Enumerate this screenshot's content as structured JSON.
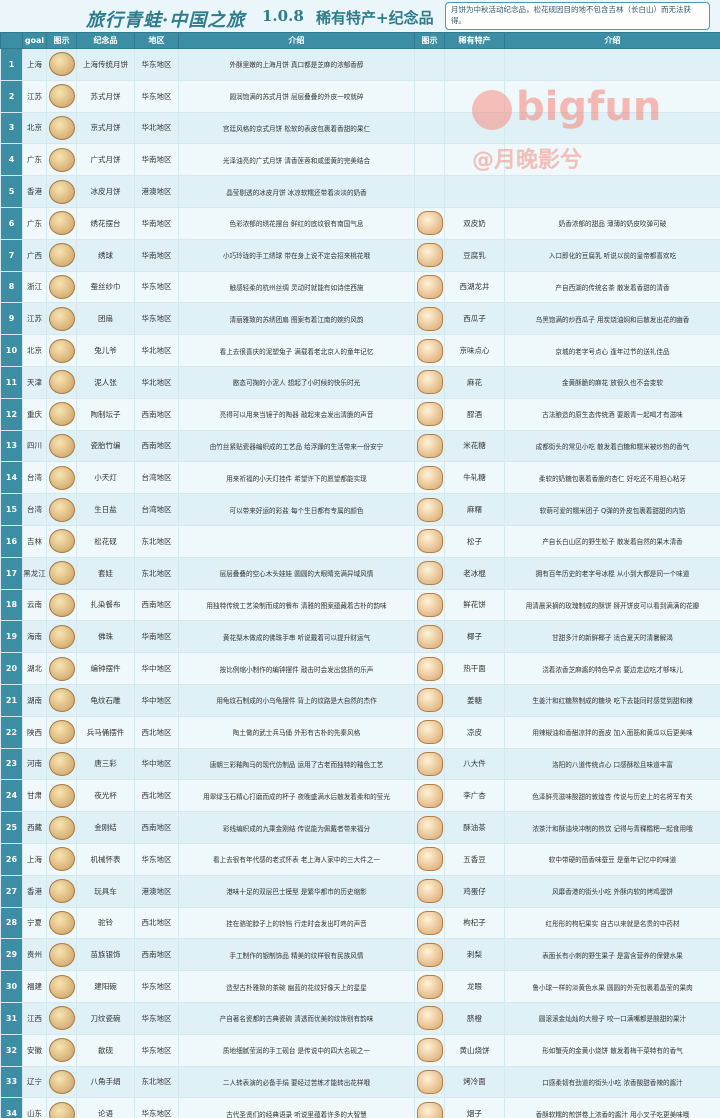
{
  "header": {
    "title": "旅行青蛙·中国之旅",
    "version": "1.0.8",
    "subtitle": "稀有特产+纪念品",
    "note": "月饼为中秋活动纪念品，松花砚因目的地不包含吉林（长白山）而无法获得。"
  },
  "watermark": {
    "brand": "bigfun",
    "author": "@月晚影兮"
  },
  "columns": [
    "goal",
    "图示",
    "纪念品",
    "地区",
    "介绍",
    "图示",
    "稀有特产",
    "介绍"
  ],
  "rows": [
    {
      "n": "1",
      "place": "上海",
      "item": "上海传统月饼",
      "region": "华东地区",
      "desc": "外酥里嫩的上海月饼 真口都是芝麻的浓郁香醇",
      "sp": "",
      "spdesc": ""
    },
    {
      "n": "2",
      "place": "江苏",
      "item": "苏式月饼",
      "region": "华东地区",
      "desc": "圆润饱满的苏式月饼 层层叠叠的外皮一咬就碎",
      "sp": "",
      "spdesc": ""
    },
    {
      "n": "3",
      "place": "北京",
      "item": "京式月饼",
      "region": "华北地区",
      "desc": "宫廷风格的京式月饼 松软的表皮包裹着香甜的果仁",
      "sp": "",
      "spdesc": ""
    },
    {
      "n": "4",
      "place": "广东",
      "item": "广式月饼",
      "region": "华南地区",
      "desc": "光泽油亮的广式月饼 清香莲蓉和咸蛋黄的完美结合",
      "sp": "",
      "spdesc": ""
    },
    {
      "n": "5",
      "place": "香港",
      "item": "冰皮月饼",
      "region": "港澳地区",
      "desc": "晶莹剔透的冰皮月饼 冰凉软糯还带着淡淡的奶香",
      "sp": "",
      "spdesc": ""
    },
    {
      "n": "6",
      "place": "广东",
      "item": "绣花摆台",
      "region": "华南地区",
      "desc": "色彩浓郁的绣花摆台 鲜红的底纹很有南国气息",
      "sp": "双皮奶",
      "spdesc": "奶香浓郁的甜品 薄薄的奶皮吹弹可破"
    },
    {
      "n": "7",
      "place": "广西",
      "item": "绣球",
      "region": "华南地区",
      "desc": "小巧玲珑的手工绣球 带在身上说不定会招来桃花哦",
      "sp": "豆腐乳",
      "spdesc": "入口即化的豆腐乳 听说以前的皇帝都喜欢吃"
    },
    {
      "n": "8",
      "place": "浙江",
      "item": "蚕丝纱巾",
      "region": "华东地区",
      "desc": "触感轻柔的杭州丝绸 灵动时就能有如诗佳西施",
      "sp": "西湖龙井",
      "spdesc": "产自西湖的传统名茶 散发着香甜的清香"
    },
    {
      "n": "9",
      "place": "江苏",
      "item": "团扇",
      "region": "华东地区",
      "desc": "清丽雅致的苏绣团扇 图案有着江南的婉约风韵",
      "sp": "西瓜子",
      "spdesc": "乌黑饱满的炒西瓜子 用炭烧油焖和后散发出花的幽香"
    },
    {
      "n": "10",
      "place": "北京",
      "item": "兔儿爷",
      "region": "华北地区",
      "desc": "看上去很喜庆的泥塑兔子 满载着老北京人的童年记忆",
      "sp": "京味点心",
      "spdesc": "京城的老字号点心 逢年过节的送礼佳品"
    },
    {
      "n": "11",
      "place": "天津",
      "item": "泥人张",
      "region": "华北地区",
      "desc": "憨态可掬的小泥人 想起了小时候的快乐时光",
      "sp": "麻花",
      "spdesc": "金黄酥脆的麻花 放很久也不会变软"
    },
    {
      "n": "12",
      "place": "重庆",
      "item": "陶制坛子",
      "region": "西南地区",
      "desc": "亮得可以用来当镜子的陶器 敲起来会发出清脆的声音",
      "sp": "醪酒",
      "spdesc": "古法酿造的原生态传统酒 要跟青一起喝才有滋味"
    },
    {
      "n": "13",
      "place": "四川",
      "item": "瓷胎竹编",
      "region": "西南地区",
      "desc": "由竹丝紧贴瓷器编织成的工艺品 给浮躁的生活带来一份安宁",
      "sp": "米花糖",
      "spdesc": "成都街头的常见小吃 散发着白糖和糯米被炒热的香气"
    },
    {
      "n": "14",
      "place": "台湾",
      "item": "小天灯",
      "region": "台湾地区",
      "desc": "用来祈福的小天灯挂件 希望许下的愿望都能实现",
      "sp": "牛轧糖",
      "spdesc": "柔软的奶糖包裹着香脆的杏仁 好吃还不用担心粘牙"
    },
    {
      "n": "15",
      "place": "台湾",
      "item": "生日盐",
      "region": "台湾地区",
      "desc": "可以带来好运的彩盐 每个生日都有专属的颜色",
      "sp": "麻糬",
      "spdesc": "软萌可爱的糯米团子 Q弹的外皮包裹着甜甜的内馅"
    },
    {
      "n": "16",
      "place": "吉林",
      "item": "松花砚",
      "region": "东北地区",
      "desc": "",
      "sp": "松子",
      "spdesc": "产自长白山区的野生松子 散发着自然的果木清香"
    },
    {
      "n": "17",
      "place": "黑龙江",
      "item": "套娃",
      "region": "东北地区",
      "desc": "层层叠叠的空心木头娃娃 圆圆的大眼睛充满异域风情",
      "sp": "老冰棍",
      "spdesc": "拥有百年历史的老字号冰棍 从小到大都是同一个味道"
    },
    {
      "n": "18",
      "place": "云南",
      "item": "扎染餐布",
      "region": "西南地区",
      "desc": "用独特传统工艺染制而成的餐布 清雅的图案蕴藏着古朴的韵味",
      "sp": "鲜花饼",
      "spdesc": "用清晨采摘的玫瑰制成的酥饼 掰开饼皮可以看到满满的花瓣"
    },
    {
      "n": "19",
      "place": "海南",
      "item": "佛珠",
      "region": "华南地区",
      "desc": "黄花梨木做成的佛珠手串 听说戴着可以提升财运气",
      "sp": "椰子",
      "spdesc": "甘甜多汁的新鲜椰子 适合夏天时清暑解渴"
    },
    {
      "n": "20",
      "place": "湖北",
      "item": "编钟摆件",
      "region": "华中地区",
      "desc": "按比例缩小制作的编钟摆件 敲击时会发出悠扬的乐声",
      "sp": "热干面",
      "spdesc": "浇着浓香芝麻酱的特色早点 要边走边吃才够味儿"
    },
    {
      "n": "21",
      "place": "湖南",
      "item": "龟纹石雕",
      "region": "华中地区",
      "desc": "用龟纹石制成的小乌龟摆件 背上的纹路是大自然的杰作",
      "sp": "姜糖",
      "spdesc": "生姜汁和红糖熬制成的糖块 吃下去能同时感觉到甜和辣"
    },
    {
      "n": "22",
      "place": "陕西",
      "item": "兵马俑摆件",
      "region": "西北地区",
      "desc": "陶土做的武士兵马俑 外形有古朴的先秦风格",
      "sp": "凉皮",
      "spdesc": "用辣椒油和香醋凉拌的面皮 加入面筋和黄瓜以后更美味"
    },
    {
      "n": "23",
      "place": "河南",
      "item": "唐三彩",
      "region": "华中地区",
      "desc": "唐朝三彩釉陶马的现代仿制品 运用了古老而独特的釉色工艺",
      "sp": "八大件",
      "spdesc": "洛阳的八道传统点心 口感酥松且味道丰富"
    },
    {
      "n": "24",
      "place": "甘肃",
      "item": "夜光杯",
      "region": "西北地区",
      "desc": "用翠绿玉石精心打磨而成的杯子 夜晚盛满水后散发着柔和的莹光",
      "sp": "李广杏",
      "spdesc": "色泽鲜亮滋味酸甜的敦煌杏 传说与历史上的名将军有关"
    },
    {
      "n": "25",
      "place": "西藏",
      "item": "金刚结",
      "region": "西南地区",
      "desc": "彩线编织成的九乘金刚结 传说能为佩戴者带来福分",
      "sp": "酥油茶",
      "spdesc": "浓茶汁和酥油块冲制的热饮 记得与青稞糌粑一起食用哦"
    },
    {
      "n": "26",
      "place": "上海",
      "item": "机械怀表",
      "region": "华东地区",
      "desc": "看上去很有年代感的老式怀表 老上海人家中的三大件之一",
      "sp": "五香豆",
      "spdesc": "软中带硬的茴香味蚕豆 是童年记忆中的味道"
    },
    {
      "n": "27",
      "place": "香港",
      "item": "玩具车",
      "region": "港澳地区",
      "desc": "港味十足的双层巴士模型 是繁华都市的历史缩影",
      "sp": "鸡蛋仔",
      "spdesc": "风靡香港的街头小吃 外酥内软的烤鸡蛋饼"
    },
    {
      "n": "28",
      "place": "宁夏",
      "item": "驼铃",
      "region": "西北地区",
      "desc": "挂在骆驼脖子上的铃铛 行走时会发出叮咚的声音",
      "sp": "枸杞子",
      "spdesc": "红彤彤的枸杞果实 自古以来就是名贵的中药材"
    },
    {
      "n": "29",
      "place": "贵州",
      "item": "苗族银饰",
      "region": "西南地区",
      "desc": "手工制作的银制饰品 精美的纹样很有民族风情",
      "sp": "刺梨",
      "spdesc": "表面长有小刺的野生果子 是富含营养的保健水果"
    },
    {
      "n": "30",
      "place": "福建",
      "item": "建阳碗",
      "region": "华东地区",
      "desc": "造型古朴雅致的茶碗 幽蓝的花纹好像天上的星星",
      "sp": "龙眼",
      "spdesc": "鲁小球一样的淡黄色水果 圆圆的外壳包裹着晶莹的果肉"
    },
    {
      "n": "31",
      "place": "江西",
      "item": "刀纹瓷碗",
      "region": "华东地区",
      "desc": "产自著名瓷都的古典瓷碗 清透而优美的纹饰别有韵味",
      "sp": "脐橙",
      "spdesc": "圆滚滚金灿灿的大橙子 咬一口满嘴都是酸甜的果汁"
    },
    {
      "n": "32",
      "place": "安徽",
      "item": "歙砚",
      "region": "华东地区",
      "desc": "质地细腻莹润的手工砚台 是传说中的四大名砚之一",
      "sp": "黄山烧饼",
      "spdesc": "形如蟹壳的金黄小烧饼 散发着梅干菜特有的香气"
    },
    {
      "n": "33",
      "place": "辽宁",
      "item": "八角手绢",
      "region": "东北地区",
      "desc": "二人转表演的必备手绢 要经过苦练才能转出花样哦",
      "sp": "烤冷面",
      "spdesc": "口感柔韧有劲道的街头小吃 浓香酸甜香辣的酱汁"
    },
    {
      "n": "34",
      "place": "山东",
      "item": "论语",
      "region": "华东地区",
      "desc": "古代圣贤们的经典语录 听说里蕴着许多的大智慧",
      "sp": "烟子",
      "spdesc": "香酥软糯的煎饼卷上浓香的酱汁 用小叉子吃更美味哦"
    }
  ]
}
